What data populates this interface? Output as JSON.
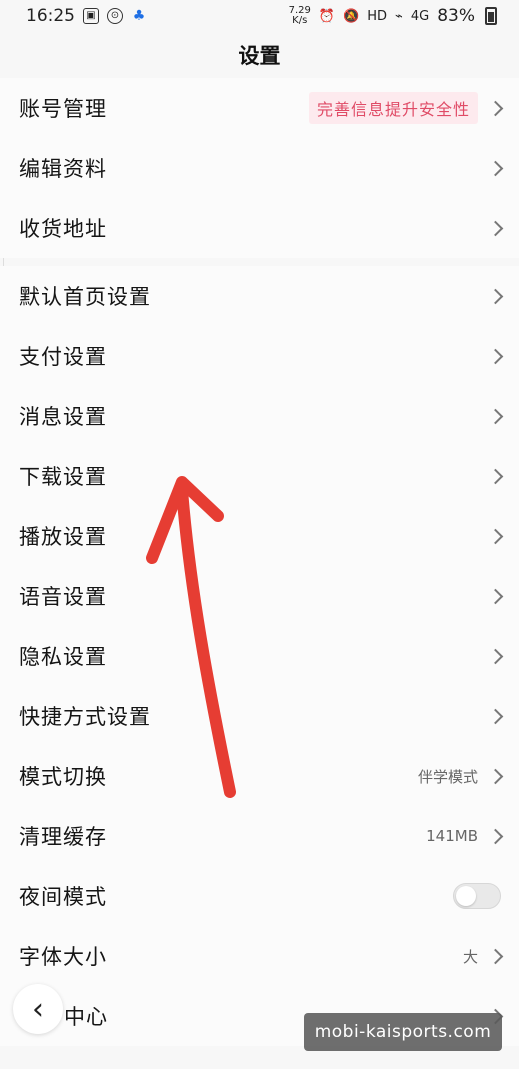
{
  "status_bar": {
    "time": "16:25",
    "speed_value": "7.29",
    "speed_unit": "K/s",
    "network_label": "HD",
    "signal_label": "4G",
    "battery": "83%"
  },
  "header": {
    "title": "设置"
  },
  "groups": [
    {
      "items": [
        {
          "label": "账号管理",
          "value": "完善信息提升安全性"
        },
        {
          "label": "编辑资料",
          "value": ""
        },
        {
          "label": "收货地址",
          "value": ""
        }
      ]
    },
    {
      "items": [
        {
          "label": "默认首页设置",
          "value": ""
        },
        {
          "label": "支付设置",
          "value": ""
        },
        {
          "label": "消息设置",
          "value": ""
        },
        {
          "label": "下载设置",
          "value": ""
        },
        {
          "label": "播放设置",
          "value": ""
        },
        {
          "label": "语音设置",
          "value": ""
        },
        {
          "label": "隐私设置",
          "value": ""
        },
        {
          "label": "快捷方式设置",
          "value": ""
        },
        {
          "label": "模式切换",
          "value": "伴学模式"
        },
        {
          "label": "清理缓存",
          "value": "141MB"
        },
        {
          "label": "夜间模式",
          "value": ""
        },
        {
          "label": "字体大小",
          "value": "大"
        },
        {
          "label": "中心",
          "value": ""
        }
      ]
    }
  ],
  "watermark": "mobi-kaisports.com",
  "colors": {
    "accent": "#e04b66",
    "annotation": "#e63d33"
  }
}
